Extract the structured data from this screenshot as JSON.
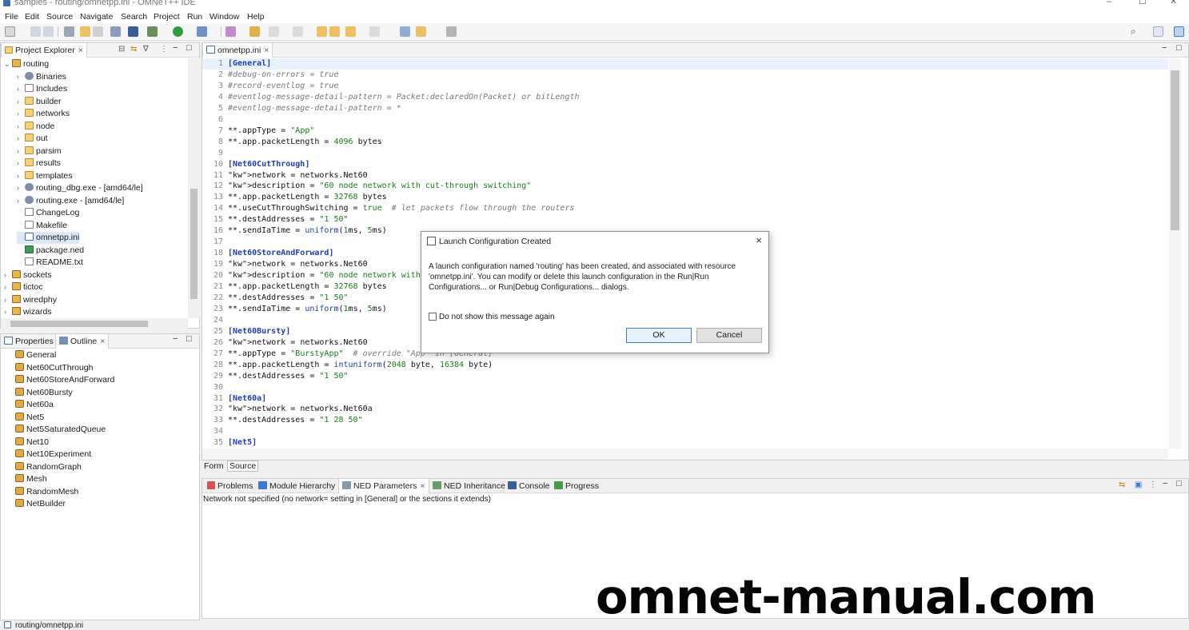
{
  "window": {
    "title": "samples - routing/omnetpp.ini - OMNeT++ IDE",
    "minimize": "–",
    "maximize": "☐",
    "close": "✕"
  },
  "menubar": [
    "File",
    "Edit",
    "Source",
    "Navigate",
    "Search",
    "Project",
    "Run",
    "Window",
    "Help"
  ],
  "project_explorer": {
    "tab_label": "Project Explorer",
    "items": [
      {
        "label": "routing",
        "icon": "project-icon",
        "expanded": true
      },
      {
        "label": "Binaries",
        "icon": "binaries-icon"
      },
      {
        "label": "Includes",
        "icon": "includes-icon"
      },
      {
        "label": "builder",
        "icon": "folder-icon"
      },
      {
        "label": "networks",
        "icon": "folder-icon"
      },
      {
        "label": "node",
        "icon": "folder-icon"
      },
      {
        "label": "out",
        "icon": "folder-icon"
      },
      {
        "label": "parsim",
        "icon": "folder-icon"
      },
      {
        "label": "results",
        "icon": "folder-icon"
      },
      {
        "label": "templates",
        "icon": "folder-icon"
      },
      {
        "label": "routing_dbg.exe - [amd64/le]",
        "icon": "exe-icon"
      },
      {
        "label": "routing.exe - [amd64/le]",
        "icon": "exe-icon"
      },
      {
        "label": "ChangeLog",
        "icon": "file-icon"
      },
      {
        "label": "Makefile",
        "icon": "makefile-icon"
      },
      {
        "label": "omnetpp.ini",
        "icon": "ini-file-icon",
        "selected": true
      },
      {
        "label": "package.ned",
        "icon": "ned-file-icon"
      },
      {
        "label": "README.txt",
        "icon": "file-icon"
      },
      {
        "label": "sockets",
        "icon": "project-icon"
      },
      {
        "label": "tictoc",
        "icon": "project-icon"
      },
      {
        "label": "wiredphy",
        "icon": "project-icon"
      },
      {
        "label": "wizards",
        "icon": "project-icon"
      }
    ]
  },
  "outline": {
    "properties_tab": "Properties",
    "outline_tab": "Outline",
    "items": [
      "General",
      "Net60CutThrough",
      "Net60StoreAndForward",
      "Net60Bursty",
      "Net60a",
      "Net5",
      "Net5SaturatedQueue",
      "Net10",
      "Net10Experiment",
      "RandomGraph",
      "Mesh",
      "RandomMesh",
      "NetBuilder"
    ]
  },
  "editor": {
    "tab_label": "omnetpp.ini",
    "bottom_tabs": [
      "Form",
      "Source"
    ],
    "lines": [
      {
        "n": "1",
        "t": "[General]"
      },
      {
        "n": "2",
        "t": "#debug-on-errors = true"
      },
      {
        "n": "3",
        "t": "#record-eventlog = true"
      },
      {
        "n": "4",
        "t": "#eventlog-message-detail-pattern = Packet:declaredOn(Packet) or bitLength"
      },
      {
        "n": "5",
        "t": "#eventlog-message-detail-pattern = *"
      },
      {
        "n": "6",
        "t": ""
      },
      {
        "n": "7",
        "t": "**.appType = \"App\""
      },
      {
        "n": "8",
        "t": "**.app.packetLength = 4096 bytes"
      },
      {
        "n": "9",
        "t": ""
      },
      {
        "n": "10",
        "t": "[Net60CutThrough]"
      },
      {
        "n": "11",
        "t": "network = networks.Net60"
      },
      {
        "n": "12",
        "t": "description = \"60 node network with cut-through switching\""
      },
      {
        "n": "13",
        "t": "**.app.packetLength = 32768 bytes"
      },
      {
        "n": "14",
        "t": "**.useCutThroughSwitching = true  # let packets flow through the routers"
      },
      {
        "n": "15",
        "t": "**.destAddresses = \"1 50\""
      },
      {
        "n": "16",
        "t": "**.sendIaTime = uniform(1ms, 5ms)"
      },
      {
        "n": "17",
        "t": ""
      },
      {
        "n": "18",
        "t": "[Net60StoreAndForward]"
      },
      {
        "n": "19",
        "t": "network = networks.Net60"
      },
      {
        "n": "20",
        "t": "description = \"60 node network with sto"
      },
      {
        "n": "21",
        "t": "**.app.packetLength = 32768 bytes"
      },
      {
        "n": "22",
        "t": "**.destAddresses = \"1 50\""
      },
      {
        "n": "23",
        "t": "**.sendIaTime = uniform(1ms, 5ms)"
      },
      {
        "n": "24",
        "t": ""
      },
      {
        "n": "25",
        "t": "[Net60Bursty]"
      },
      {
        "n": "26",
        "t": "network = networks.Net60"
      },
      {
        "n": "27",
        "t": "**.appType = \"BurstyApp\"  # override \"App\" in [General]"
      },
      {
        "n": "28",
        "t": "**.app.packetLength = intuniform(2048 byte, 16384 byte)"
      },
      {
        "n": "29",
        "t": "**.destAddresses = \"1 50\""
      },
      {
        "n": "30",
        "t": ""
      },
      {
        "n": "31",
        "t": "[Net60a]"
      },
      {
        "n": "32",
        "t": "network = networks.Net60a"
      },
      {
        "n": "33",
        "t": "**.destAddresses = \"1 28 50\""
      },
      {
        "n": "34",
        "t": ""
      },
      {
        "n": "35",
        "t": "[Net5]"
      }
    ]
  },
  "dialog": {
    "title": "Launch Configuration Created",
    "message": "A launch configuration named 'routing' has been created, and associated with resource 'omnetpp.ini'. You can modify or delete this launch configuration in the Run|Run Configurations... or Run|Debug Configurations... dialogs.",
    "checkbox_label": "Do not show this message again",
    "ok_label": "OK",
    "cancel_label": "Cancel"
  },
  "bottom_panel": {
    "tabs": [
      "Problems",
      "Module Hierarchy",
      "NED Parameters",
      "NED Inheritance",
      "Console",
      "Progress"
    ],
    "message": "Network not specified (no network= setting in [General] or the sections it extends)"
  },
  "status": {
    "path": "routing/omnetpp.ini"
  },
  "watermark": "omnet-manual.com"
}
